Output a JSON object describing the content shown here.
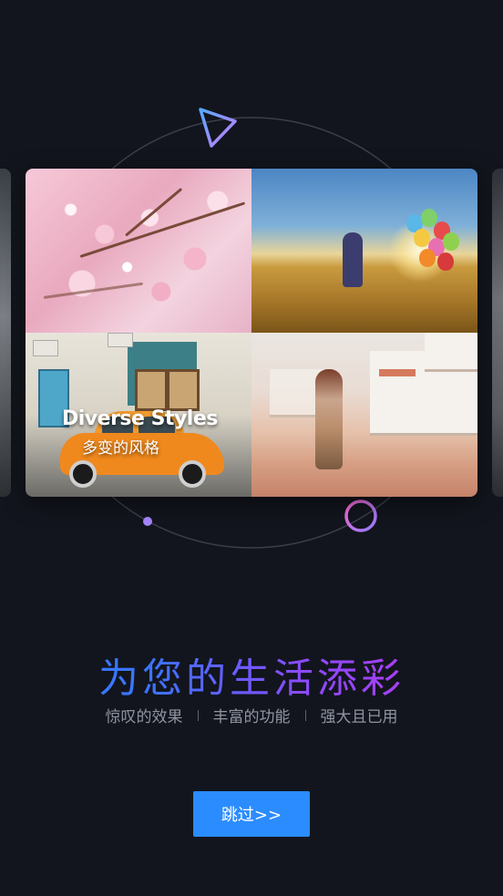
{
  "slide": {
    "overlay_title": "Diverse Styles",
    "overlay_subtitle": "多变的风格"
  },
  "heading": {
    "title": "为您的生活添彩"
  },
  "features": [
    {
      "label": "惊叹的效果"
    },
    {
      "label": "丰富的功能"
    },
    {
      "label": "强大且已用"
    }
  ],
  "skip_button": {
    "label": "跳过>>"
  },
  "colors": {
    "background": "#12151d",
    "accent_blue": "#2b8cff",
    "gradient_start": "#2f7bff",
    "gradient_end": "#c233e6"
  },
  "icons": [
    "triangle-play-icon",
    "ring-icon",
    "dot-icon"
  ]
}
